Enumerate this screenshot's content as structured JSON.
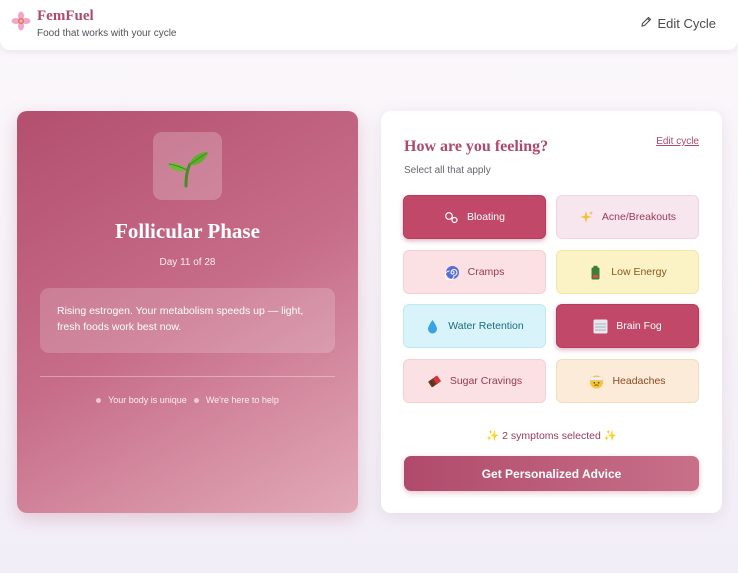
{
  "header": {
    "brand": "FemFuel",
    "tagline": "Food that works with your cycle",
    "edit_cycle": "Edit Cycle",
    "logo_icon": "flower-icon"
  },
  "phase": {
    "icon": "seedling-icon",
    "title": "Follicular Phase",
    "day": "Day 11 of 28",
    "description": "Rising estrogen. Your metabolism speeds up — light, fresh foods work best now.",
    "note_1": "Your body is unique",
    "note_2": "We're here to help"
  },
  "symptoms_panel": {
    "title": "How are you feeling?",
    "edit_link": "Edit cycle",
    "hint": "Select all that apply",
    "items": [
      {
        "label": "Bloating",
        "icon": "bubbles-icon",
        "selected": true
      },
      {
        "label": "Acne/Breakouts",
        "icon": "sparkles-icon",
        "selected": false
      },
      {
        "label": "Cramps",
        "icon": "swirl-icon",
        "selected": false
      },
      {
        "label": "Low Energy",
        "icon": "battery-icon",
        "selected": false
      },
      {
        "label": "Water Retention",
        "icon": "droplet-icon",
        "selected": false
      },
      {
        "label": "Brain Fog",
        "icon": "fog-icon",
        "selected": true
      },
      {
        "label": "Sugar Cravings",
        "icon": "chocolate-icon",
        "selected": false
      },
      {
        "label": "Headaches",
        "icon": "bandaged-face-icon",
        "selected": false
      }
    ],
    "selected_count": "✨ 2 symptoms selected ✨",
    "cta": "Get Personalized Advice"
  },
  "colors": {
    "accent": "#b04a6c",
    "selected": "#c14868"
  }
}
